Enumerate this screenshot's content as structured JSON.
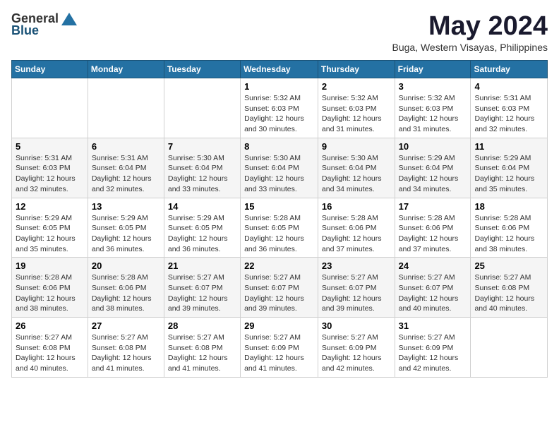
{
  "header": {
    "logo_general": "General",
    "logo_blue": "Blue",
    "month": "May 2024",
    "location": "Buga, Western Visayas, Philippines"
  },
  "weekdays": [
    "Sunday",
    "Monday",
    "Tuesday",
    "Wednesday",
    "Thursday",
    "Friday",
    "Saturday"
  ],
  "weeks": [
    [
      {
        "day": "",
        "sunrise": "",
        "sunset": "",
        "daylight": ""
      },
      {
        "day": "",
        "sunrise": "",
        "sunset": "",
        "daylight": ""
      },
      {
        "day": "",
        "sunrise": "",
        "sunset": "",
        "daylight": ""
      },
      {
        "day": "1",
        "sunrise": "Sunrise: 5:32 AM",
        "sunset": "Sunset: 6:03 PM",
        "daylight": "Daylight: 12 hours and 30 minutes."
      },
      {
        "day": "2",
        "sunrise": "Sunrise: 5:32 AM",
        "sunset": "Sunset: 6:03 PM",
        "daylight": "Daylight: 12 hours and 31 minutes."
      },
      {
        "day": "3",
        "sunrise": "Sunrise: 5:32 AM",
        "sunset": "Sunset: 6:03 PM",
        "daylight": "Daylight: 12 hours and 31 minutes."
      },
      {
        "day": "4",
        "sunrise": "Sunrise: 5:31 AM",
        "sunset": "Sunset: 6:03 PM",
        "daylight": "Daylight: 12 hours and 32 minutes."
      }
    ],
    [
      {
        "day": "5",
        "sunrise": "Sunrise: 5:31 AM",
        "sunset": "Sunset: 6:03 PM",
        "daylight": "Daylight: 12 hours and 32 minutes."
      },
      {
        "day": "6",
        "sunrise": "Sunrise: 5:31 AM",
        "sunset": "Sunset: 6:04 PM",
        "daylight": "Daylight: 12 hours and 32 minutes."
      },
      {
        "day": "7",
        "sunrise": "Sunrise: 5:30 AM",
        "sunset": "Sunset: 6:04 PM",
        "daylight": "Daylight: 12 hours and 33 minutes."
      },
      {
        "day": "8",
        "sunrise": "Sunrise: 5:30 AM",
        "sunset": "Sunset: 6:04 PM",
        "daylight": "Daylight: 12 hours and 33 minutes."
      },
      {
        "day": "9",
        "sunrise": "Sunrise: 5:30 AM",
        "sunset": "Sunset: 6:04 PM",
        "daylight": "Daylight: 12 hours and 34 minutes."
      },
      {
        "day": "10",
        "sunrise": "Sunrise: 5:29 AM",
        "sunset": "Sunset: 6:04 PM",
        "daylight": "Daylight: 12 hours and 34 minutes."
      },
      {
        "day": "11",
        "sunrise": "Sunrise: 5:29 AM",
        "sunset": "Sunset: 6:04 PM",
        "daylight": "Daylight: 12 hours and 35 minutes."
      }
    ],
    [
      {
        "day": "12",
        "sunrise": "Sunrise: 5:29 AM",
        "sunset": "Sunset: 6:05 PM",
        "daylight": "Daylight: 12 hours and 35 minutes."
      },
      {
        "day": "13",
        "sunrise": "Sunrise: 5:29 AM",
        "sunset": "Sunset: 6:05 PM",
        "daylight": "Daylight: 12 hours and 36 minutes."
      },
      {
        "day": "14",
        "sunrise": "Sunrise: 5:29 AM",
        "sunset": "Sunset: 6:05 PM",
        "daylight": "Daylight: 12 hours and 36 minutes."
      },
      {
        "day": "15",
        "sunrise": "Sunrise: 5:28 AM",
        "sunset": "Sunset: 6:05 PM",
        "daylight": "Daylight: 12 hours and 36 minutes."
      },
      {
        "day": "16",
        "sunrise": "Sunrise: 5:28 AM",
        "sunset": "Sunset: 6:06 PM",
        "daylight": "Daylight: 12 hours and 37 minutes."
      },
      {
        "day": "17",
        "sunrise": "Sunrise: 5:28 AM",
        "sunset": "Sunset: 6:06 PM",
        "daylight": "Daylight: 12 hours and 37 minutes."
      },
      {
        "day": "18",
        "sunrise": "Sunrise: 5:28 AM",
        "sunset": "Sunset: 6:06 PM",
        "daylight": "Daylight: 12 hours and 38 minutes."
      }
    ],
    [
      {
        "day": "19",
        "sunrise": "Sunrise: 5:28 AM",
        "sunset": "Sunset: 6:06 PM",
        "daylight": "Daylight: 12 hours and 38 minutes."
      },
      {
        "day": "20",
        "sunrise": "Sunrise: 5:28 AM",
        "sunset": "Sunset: 6:06 PM",
        "daylight": "Daylight: 12 hours and 38 minutes."
      },
      {
        "day": "21",
        "sunrise": "Sunrise: 5:27 AM",
        "sunset": "Sunset: 6:07 PM",
        "daylight": "Daylight: 12 hours and 39 minutes."
      },
      {
        "day": "22",
        "sunrise": "Sunrise: 5:27 AM",
        "sunset": "Sunset: 6:07 PM",
        "daylight": "Daylight: 12 hours and 39 minutes."
      },
      {
        "day": "23",
        "sunrise": "Sunrise: 5:27 AM",
        "sunset": "Sunset: 6:07 PM",
        "daylight": "Daylight: 12 hours and 39 minutes."
      },
      {
        "day": "24",
        "sunrise": "Sunrise: 5:27 AM",
        "sunset": "Sunset: 6:07 PM",
        "daylight": "Daylight: 12 hours and 40 minutes."
      },
      {
        "day": "25",
        "sunrise": "Sunrise: 5:27 AM",
        "sunset": "Sunset: 6:08 PM",
        "daylight": "Daylight: 12 hours and 40 minutes."
      }
    ],
    [
      {
        "day": "26",
        "sunrise": "Sunrise: 5:27 AM",
        "sunset": "Sunset: 6:08 PM",
        "daylight": "Daylight: 12 hours and 40 minutes."
      },
      {
        "day": "27",
        "sunrise": "Sunrise: 5:27 AM",
        "sunset": "Sunset: 6:08 PM",
        "daylight": "Daylight: 12 hours and 41 minutes."
      },
      {
        "day": "28",
        "sunrise": "Sunrise: 5:27 AM",
        "sunset": "Sunset: 6:08 PM",
        "daylight": "Daylight: 12 hours and 41 minutes."
      },
      {
        "day": "29",
        "sunrise": "Sunrise: 5:27 AM",
        "sunset": "Sunset: 6:09 PM",
        "daylight": "Daylight: 12 hours and 41 minutes."
      },
      {
        "day": "30",
        "sunrise": "Sunrise: 5:27 AM",
        "sunset": "Sunset: 6:09 PM",
        "daylight": "Daylight: 12 hours and 42 minutes."
      },
      {
        "day": "31",
        "sunrise": "Sunrise: 5:27 AM",
        "sunset": "Sunset: 6:09 PM",
        "daylight": "Daylight: 12 hours and 42 minutes."
      },
      {
        "day": "",
        "sunrise": "",
        "sunset": "",
        "daylight": ""
      }
    ]
  ]
}
